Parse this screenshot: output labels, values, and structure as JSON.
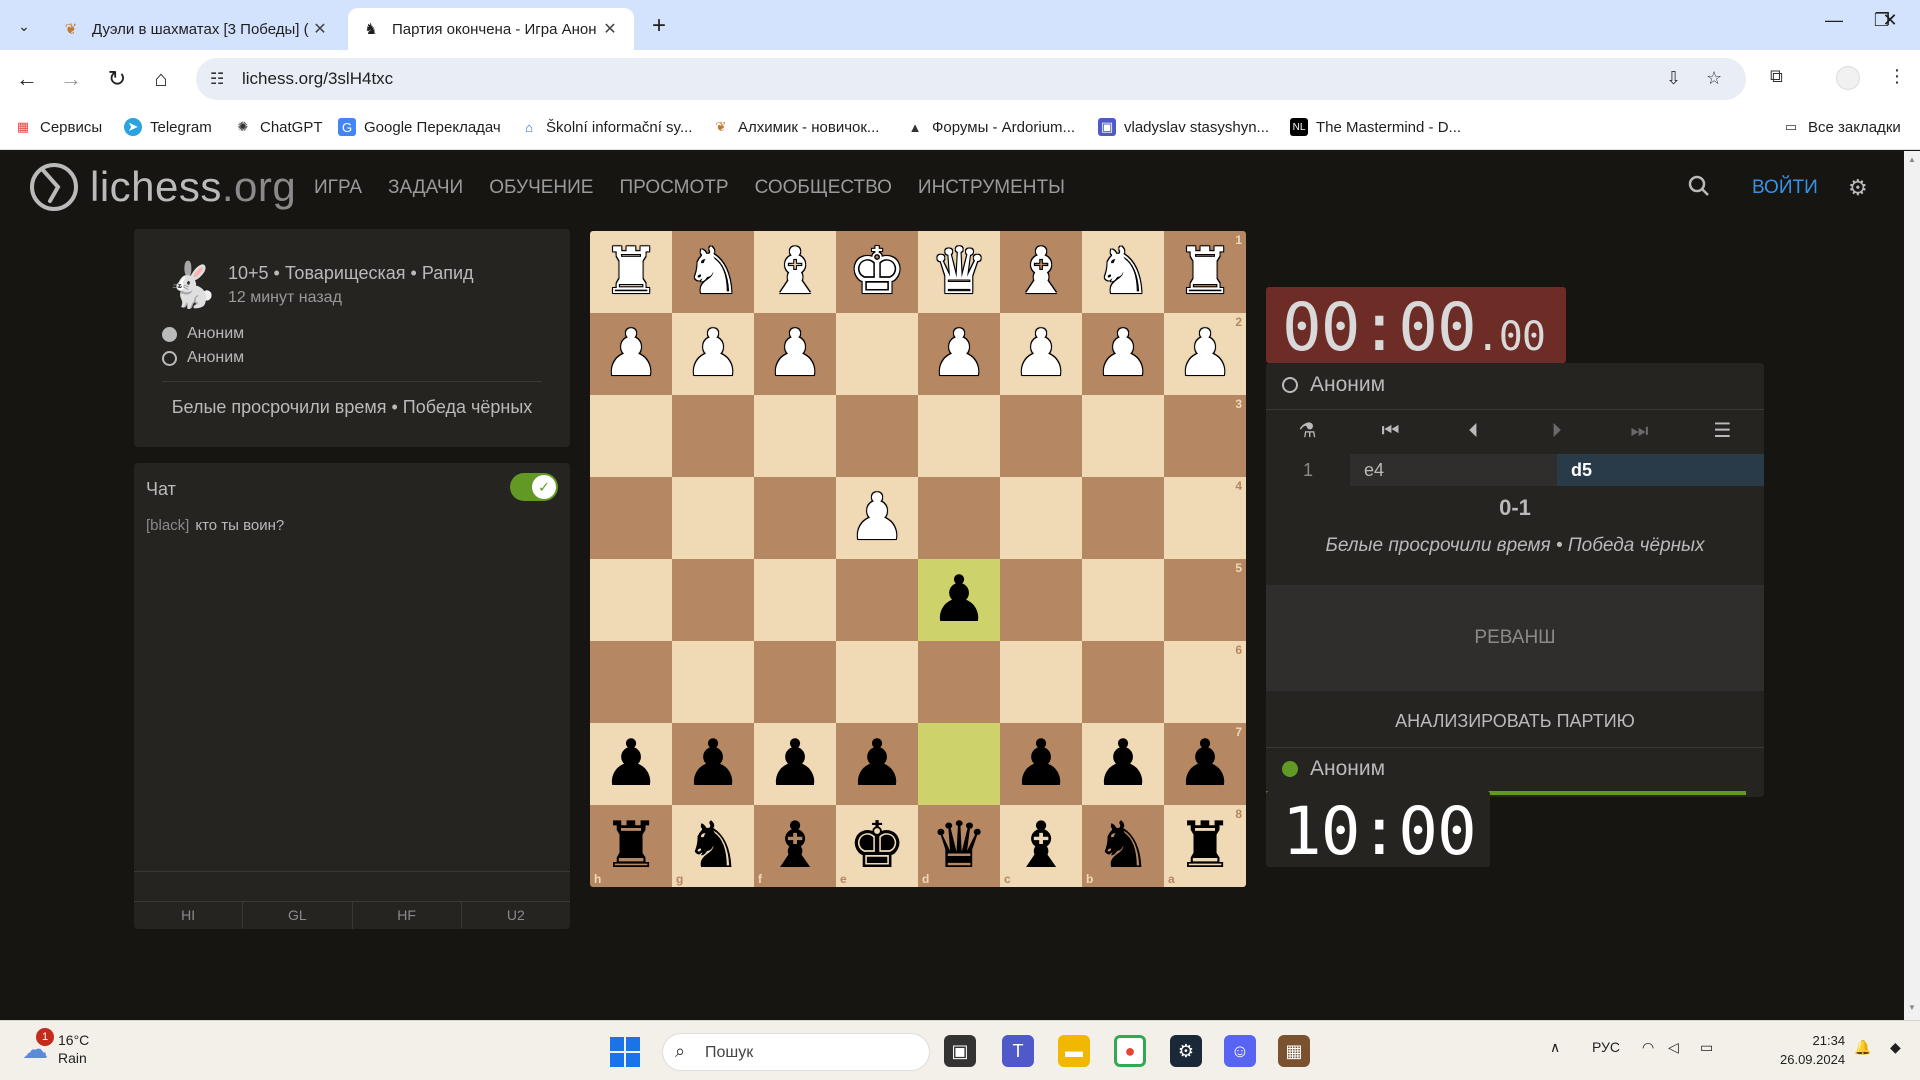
{
  "browser": {
    "tabs": [
      {
        "title": "Дуэли в шахматах [3 Победы] (",
        "active": false
      },
      {
        "title": "Партия окончена - Игра Анон",
        "active": true
      }
    ],
    "url": "lichess.org/3slH4txc",
    "bookmarks": [
      "Сервисы",
      "Telegram",
      "ChatGPT",
      "Google Перекладач",
      "Školní informační sy...",
      "Алхимик - новичок...",
      "Форумы - Ardorium...",
      "vladyslav stasyshyn...",
      "The Mastermind - D..."
    ],
    "all_bookmarks": "Все закладки"
  },
  "site": {
    "logo_main": "lichess",
    "logo_tld": ".org",
    "nav": [
      "ИГРА",
      "ЗАДАЧИ",
      "ОБУЧЕНИЕ",
      "ПРОСМОТР",
      "СООБЩЕСТВО",
      "ИНСТРУМЕНТЫ"
    ],
    "signin": "ВОЙТИ"
  },
  "game_info": {
    "meta": "10+5 • Товарищеская • Рапид",
    "ago": "12 минут назад",
    "white_player": "Аноним",
    "black_player": "Аноним",
    "result": "Белые просрочили время • Победа чёрных"
  },
  "chat": {
    "title": "Чат",
    "messages": [
      {
        "user": "[black]",
        "text": "кто ты воин?"
      }
    ],
    "presets": [
      "HI",
      "GL",
      "HF",
      "U2"
    ]
  },
  "board": {
    "orientation": "black",
    "ranks": [
      "1",
      "2",
      "3",
      "4",
      "5",
      "6",
      "7",
      "8"
    ],
    "files": [
      "h",
      "g",
      "f",
      "e",
      "d",
      "c",
      "b",
      "a"
    ],
    "rows": [
      [
        "wR",
        "wN",
        "wB",
        "wK",
        "wQ",
        "wB",
        "wN",
        "wR"
      ],
      [
        "wP",
        "wP",
        "wP",
        "",
        "wP",
        "wP",
        "wP",
        "wP"
      ],
      [
        "",
        "",
        "",
        "",
        "",
        "",
        "",
        ""
      ],
      [
        "",
        "",
        "",
        "wP",
        "",
        "",
        "",
        ""
      ],
      [
        "",
        "",
        "",
        "",
        "bP",
        "",
        "",
        ""
      ],
      [
        "",
        "",
        "",
        "",
        "",
        "",
        "",
        ""
      ],
      [
        "bP",
        "bP",
        "bP",
        "bP",
        "",
        "bP",
        "bP",
        "bP"
      ],
      [
        "bR",
        "bN",
        "bB",
        "bK",
        "bQ",
        "bB",
        "bN",
        "bR"
      ]
    ],
    "last_move": [
      "d7",
      "d5"
    ]
  },
  "right_panel": {
    "top_clock": {
      "main": "00:00",
      "cs": ".00"
    },
    "top_player": "Аноним",
    "moves": [
      {
        "num": "1",
        "white": "e4",
        "black": "d5"
      }
    ],
    "score": "0-1",
    "status": "Белые просрочили время • Победа чёрных",
    "rematch": "РЕВАНШ",
    "analyse": "АНАЛИЗИРОВАТЬ ПАРТИЮ",
    "bottom_player": "Аноним",
    "bottom_clock": {
      "main": "10:00"
    }
  },
  "taskbar": {
    "weather_temp": "16°C",
    "weather_desc": "Rain",
    "weather_badge": "1",
    "search_placeholder": "Пошук",
    "lang": "РУС",
    "time": "21:34",
    "date": "26.09.2024"
  }
}
